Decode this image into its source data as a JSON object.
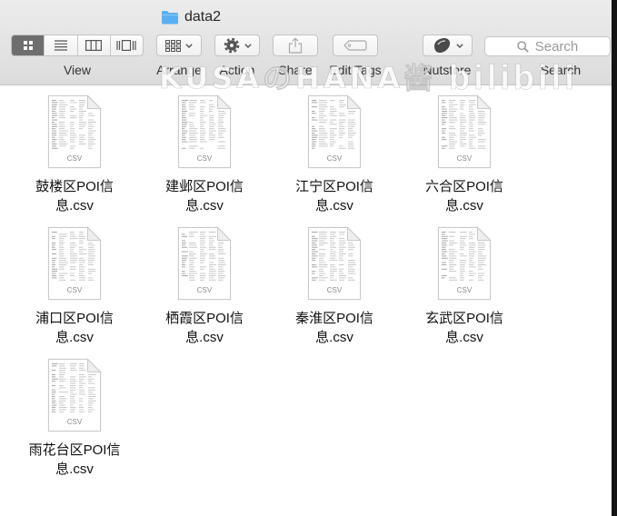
{
  "window": {
    "title": "data2",
    "title_icon": "folder-icon"
  },
  "toolbar": {
    "view": {
      "label": "View",
      "modes": [
        {
          "icon": "icon-view-icon",
          "selected": true
        },
        {
          "icon": "list-view-icon",
          "selected": false
        },
        {
          "icon": "column-view-icon",
          "selected": false
        },
        {
          "icon": "cover-flow-view-icon",
          "selected": false
        }
      ]
    },
    "arrange": {
      "label": "Arrange",
      "icon": "arrange-grid-icon"
    },
    "action": {
      "label": "Action",
      "icon": "gear-icon"
    },
    "share": {
      "label": "Share",
      "icon": "share-icon",
      "enabled": false
    },
    "edit_tags": {
      "label": "Edit Tags",
      "icon": "tag-icon",
      "enabled": false
    },
    "nutstore": {
      "label": "Nutstore",
      "icon": "nutstore-icon"
    },
    "search": {
      "label": "Search",
      "placeholder": "Search",
      "icon": "search-icon"
    }
  },
  "watermark": {
    "text": "KUSAのHANA酱",
    "logo": "bilibili"
  },
  "files": [
    {
      "label": [
        "鼓楼区POI信",
        "息.csv"
      ],
      "icon": "csv-file-icon",
      "badge": "CSV"
    },
    {
      "label": [
        "建邺区POI信",
        "息.csv"
      ],
      "icon": "csv-file-icon",
      "badge": "CSV"
    },
    {
      "label": [
        "江宁区POI信",
        "息.csv"
      ],
      "icon": "csv-file-icon",
      "badge": "CSV"
    },
    {
      "label": [
        "六合区POI信",
        "息.csv"
      ],
      "icon": "csv-file-icon",
      "badge": "CSV"
    },
    {
      "label": [
        "浦口区POI信",
        "息.csv"
      ],
      "icon": "csv-file-icon",
      "badge": "CSV"
    },
    {
      "label": [
        "栖霞区POI信",
        "息.csv"
      ],
      "icon": "csv-file-icon",
      "badge": "CSV"
    },
    {
      "label": [
        "秦淮区POI信",
        "息.csv"
      ],
      "icon": "csv-file-icon",
      "badge": "CSV"
    },
    {
      "label": [
        "玄武区POI信",
        "息.csv"
      ],
      "icon": "csv-file-icon",
      "badge": "CSV"
    },
    {
      "label": [
        "雨花台区POI信",
        "息.csv"
      ],
      "icon": "csv-file-icon",
      "badge": "CSV"
    }
  ],
  "colors": {
    "selected_segment": "#6e6e6e",
    "folder": "#5aaff2",
    "disabled_icon": "#a9a9a9",
    "toolbar_top": "#ececec",
    "toolbar_bottom": "#dcdcdc"
  }
}
